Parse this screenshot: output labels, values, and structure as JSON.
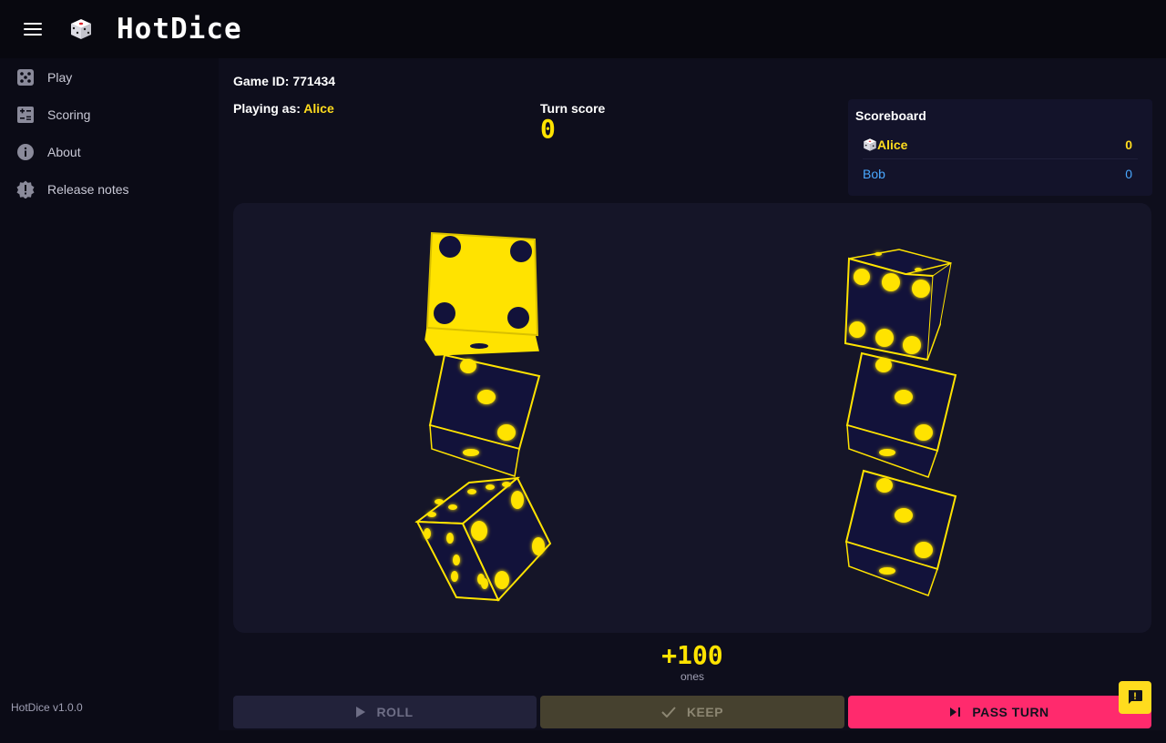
{
  "app": {
    "title": "HotDice",
    "version": "HotDice v1.0.0"
  },
  "sidebar": {
    "items": [
      {
        "label": "Play",
        "icon": "dice-icon"
      },
      {
        "label": "Scoring",
        "icon": "calculator-icon"
      },
      {
        "label": "About",
        "icon": "info-icon"
      },
      {
        "label": "Release notes",
        "icon": "badge-alert-icon"
      }
    ]
  },
  "game": {
    "id_label": "Game ID: 771434",
    "playing_as_label": "Playing as:",
    "player_name": "Alice",
    "turn_score_label": "Turn score",
    "turn_score": "0"
  },
  "scoreboard": {
    "title": "Scoreboard",
    "players": [
      {
        "name": "Alice",
        "score": "0",
        "active": true
      },
      {
        "name": "Bob",
        "score": "0",
        "active": false
      }
    ]
  },
  "dice": {
    "left_column": [
      {
        "face": 4,
        "kept": true
      },
      {
        "face": 3,
        "kept": false
      },
      {
        "face": 2,
        "kept": false
      }
    ],
    "right_column": [
      {
        "face": 6,
        "kept": false
      },
      {
        "face": 3,
        "kept": false
      },
      {
        "face": 3,
        "kept": false
      }
    ]
  },
  "points": {
    "value": "+100",
    "label": "ones"
  },
  "actions": {
    "roll": "ROLL",
    "keep": "KEEP",
    "pass": "PASS TURN"
  },
  "colors": {
    "accent": "#ffe300",
    "pass": "#ff2a6d",
    "die_body": "#12123a",
    "player_other": "#4aa8ff"
  }
}
